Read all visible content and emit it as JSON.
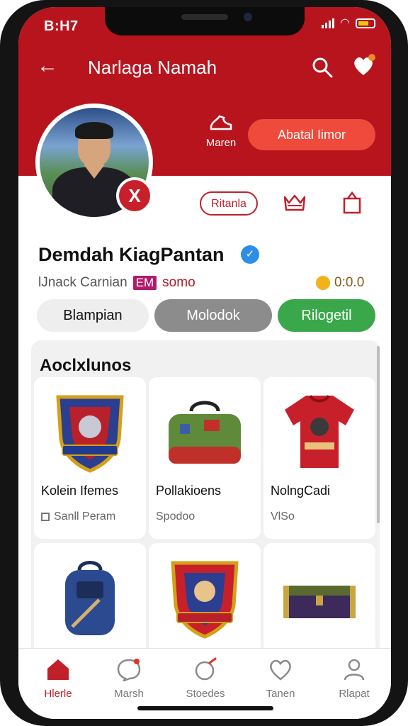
{
  "status_bar": {
    "time": "B:H7"
  },
  "header": {
    "title": "Narlaga Namah",
    "bg_color": "#b8141e"
  },
  "profile": {
    "mini_action_label": "Maren",
    "cta_label": "Abatal Iimor",
    "chip_label": "Ritanla",
    "name": "Demdah KiagPantan",
    "handle": "lJnack Carnian",
    "tag": "EM",
    "tag_text": "somo",
    "coins": "0:0.0"
  },
  "tabs": [
    {
      "label": "Blampian"
    },
    {
      "label": "Molodok"
    },
    {
      "label": "Rilogetil"
    }
  ],
  "section": {
    "title": "Aoclxlunos",
    "items": [
      {
        "title": "Kolein Ifemes",
        "subtitle": "Sanll Peram",
        "icon": "shield-emblem-icon"
      },
      {
        "title": "Pollakioens",
        "subtitle": "Spodoo",
        "icon": "duffel-bag-icon"
      },
      {
        "title": "NolngCadi",
        "subtitle": "VlSo",
        "icon": "jersey-icon"
      },
      {
        "title": "",
        "subtitle": "",
        "icon": "backpack-icon"
      },
      {
        "title": "",
        "subtitle": "",
        "icon": "shield-emblem-icon"
      },
      {
        "title": "",
        "subtitle": "",
        "icon": "chest-icon"
      }
    ]
  },
  "bottom_nav": [
    {
      "label": "Hlerle",
      "icon": "home-icon",
      "active": true
    },
    {
      "label": "Marsh",
      "icon": "chat-icon",
      "active": false
    },
    {
      "label": "Stoedes",
      "icon": "stories-icon",
      "active": false
    },
    {
      "label": "Tanen",
      "icon": "heart-icon",
      "active": false
    },
    {
      "label": "Rlapat",
      "icon": "profile-icon",
      "active": false
    }
  ]
}
